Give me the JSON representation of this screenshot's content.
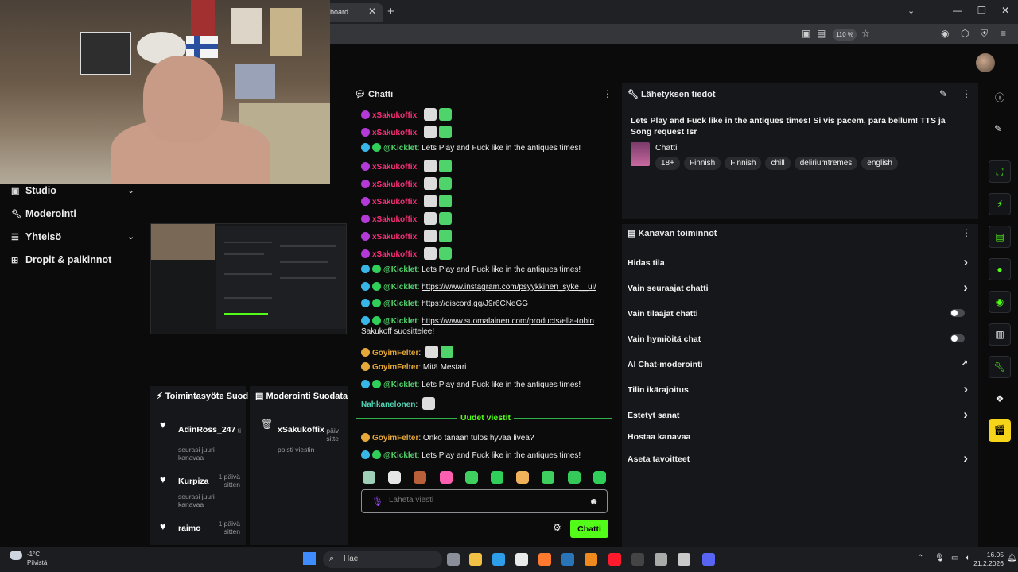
{
  "browser": {
    "tab_label": "board",
    "zoom": "110 %"
  },
  "sidebar": [
    {
      "label": "Studio",
      "has_chevron": true
    },
    {
      "label": "Moderointi",
      "has_chevron": false
    },
    {
      "label": "Yhteisö",
      "has_chevron": true
    },
    {
      "label": "Dropit & palkinnot",
      "has_chevron": false
    }
  ],
  "activity": {
    "title": "Toimintasyöte",
    "title_cut": "Suod",
    "items": [
      {
        "name": "AdinRoss_247",
        "time": "ti",
        "sub": "seurasi juuri kanavaa"
      },
      {
        "name": "Kurpiza",
        "time": "1 päivä sitten",
        "sub": "seurasi juuri kanavaa"
      },
      {
        "name": "raimo",
        "time": "1 päivä sitten",
        "sub": ""
      }
    ]
  },
  "modlog": {
    "title": "Moderointi",
    "title_cut": "Suodata",
    "item": {
      "name": "xSakukoffix",
      "time": "päiv sitte",
      "sub": "poisti viestin"
    }
  },
  "chat": {
    "title": "Chatti",
    "messages": [
      {
        "user": "xSakukoffix",
        "sep": ":",
        "text": ""
      },
      {
        "user": "xSakukoffix",
        "sep": ":",
        "text": ""
      },
      {
        "user": "@Kicklet",
        "sep": ":",
        "text": "Lets Play and Fuck like in the antiques times!"
      },
      {
        "user": "xSakukoffix",
        "sep": ":",
        "text": ""
      },
      {
        "user": "xSakukoffix",
        "sep": ":",
        "text": ""
      },
      {
        "user": "xSakukoffix",
        "sep": ":",
        "text": ""
      },
      {
        "user": "xSakukoffix",
        "sep": ":",
        "text": ""
      },
      {
        "user": "xSakukoffix",
        "sep": ":",
        "text": ""
      },
      {
        "user": "xSakukoffix",
        "sep": ":",
        "text": ""
      },
      {
        "user": "@Kicklet",
        "sep": ":",
        "text": "Lets Play and Fuck like in the antiques times!"
      },
      {
        "user": "@Kicklet",
        "sep": ":",
        "link": "https://www.instagram.com/psyykkinen_syke__ui/"
      },
      {
        "user": "@Kicklet",
        "sep": ":",
        "link": "https://discord.gg/J9r6CNeGG"
      },
      {
        "user": "@Kicklet",
        "sep": ":",
        "link": "https://www.suomalainen.com/products/ella-tobin",
        "text2": "Sakukoff suosittelee!"
      },
      {
        "user": "GoyimFelter",
        "sep": ":",
        "text": ""
      },
      {
        "user": "GoyimFelter",
        "sep": ":",
        "text": "Mitä Mestari"
      },
      {
        "user": "@Kicklet",
        "sep": ":",
        "text": "Lets Play and Fuck like in the antiques times!"
      },
      {
        "user": "Nahkanelonen",
        "sep": ":",
        "text": ""
      }
    ],
    "new_messages_label": "Uudet viestit",
    "new_messages": [
      {
        "user": "GoyimFelter",
        "sep": ":",
        "text": "Onko tänään tulos hyvää liveä?"
      },
      {
        "user": "@Kicklet",
        "sep": ":",
        "text": "Lets Play and Fuck like in the antiques times!"
      }
    ],
    "input_placeholder": "Lähetä viesti",
    "send_label": "Chatti"
  },
  "stream_info": {
    "title": "Lähetyksen tiedot",
    "stream_title": "Lets Play and Fuck like in the antiques times! Si vis pacem, para bellum! TTS ja Song request !sr",
    "category": "Chatti",
    "tags": [
      "18+",
      "Finnish",
      "Finnish",
      "chill",
      "deliriumtremes",
      "english"
    ]
  },
  "channel_actions": {
    "title": "Kanavan toiminnot",
    "rows": [
      {
        "label": "Hidas tila",
        "control": "chevron"
      },
      {
        "label": "Vain seuraajat chatti",
        "control": "chevron"
      },
      {
        "label": "Vain tilaajat chatti",
        "control": "toggle"
      },
      {
        "label": "Vain hymiöitä chat",
        "control": "toggle"
      },
      {
        "label": "AI Chat-moderointi",
        "control": "external"
      },
      {
        "label": "Tilin ikärajoitus",
        "control": "chevron"
      },
      {
        "label": "Estetyt sanat",
        "control": "chevron"
      },
      {
        "label": "Hostaa kanavaa",
        "control": "none"
      },
      {
        "label": "Aseta tavoitteet",
        "control": "chevron"
      }
    ]
  },
  "taskbar": {
    "weather_temp": "-1°C",
    "weather_desc": "Pilvistä",
    "search_label": "Hae",
    "time": "16.05",
    "date": "21.2.2026"
  }
}
